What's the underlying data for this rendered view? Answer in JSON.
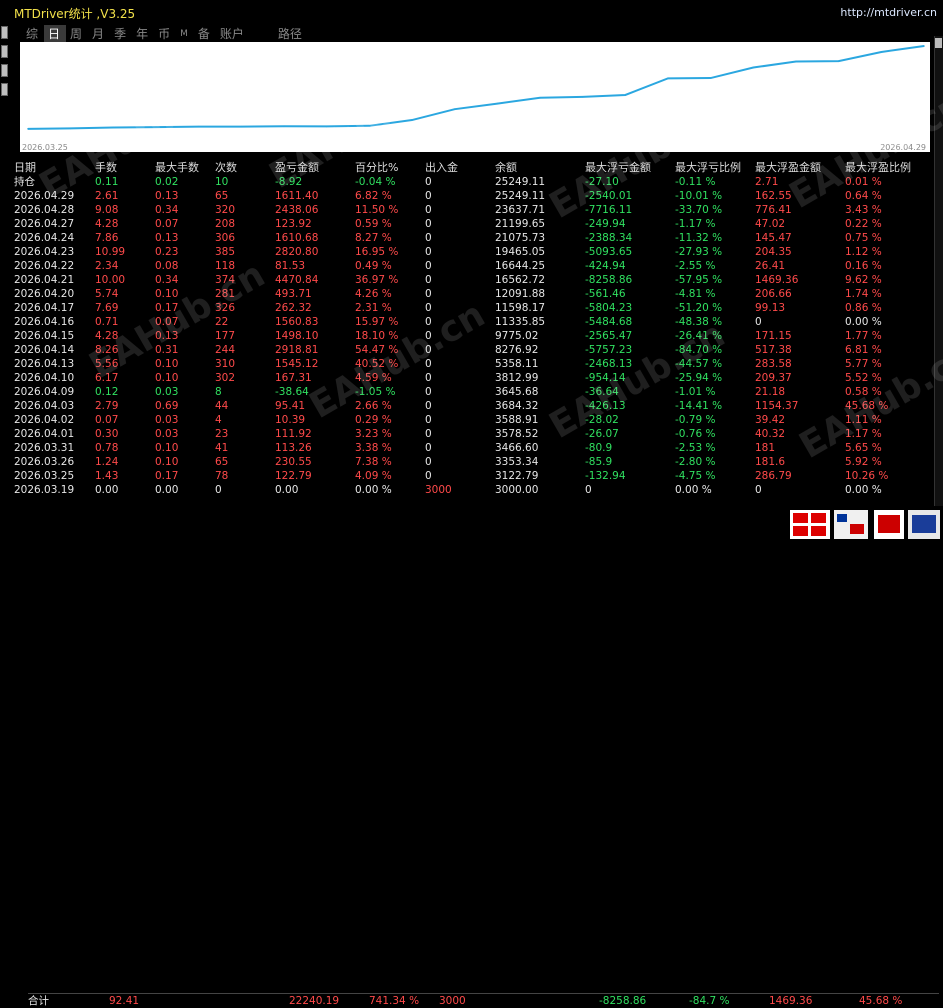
{
  "title": "MTDriver统计 ,V3.25",
  "url": "http://mtdriver.cn",
  "tabs": [
    "综",
    "日",
    "周",
    "月",
    "季",
    "年",
    "币",
    "M",
    "备",
    "账户",
    "路径"
  ],
  "active_tab": "日",
  "chart_data": {
    "type": "line",
    "x_start_label": "2026.03.25",
    "x_end_label": "2026.04.29",
    "x": [
      "2026.03.19",
      "2026.03.25",
      "2026.03.26",
      "2026.03.31",
      "2026.04.01",
      "2026.04.02",
      "2026.04.03",
      "2026.04.09",
      "2026.04.10",
      "2026.04.13",
      "2026.04.14",
      "2026.04.15",
      "2026.04.16",
      "2026.04.17",
      "2026.04.20",
      "2026.04.21",
      "2026.04.22",
      "2026.04.23",
      "2026.04.24",
      "2026.04.27",
      "2026.04.28",
      "2026.04.29"
    ],
    "values": [
      3000.0,
      3122.79,
      3353.34,
      3466.6,
      3578.52,
      3588.91,
      3684.32,
      3645.68,
      3812.99,
      5358.11,
      8276.92,
      9775.02,
      11335.85,
      11598.17,
      12091.88,
      16562.72,
      16644.25,
      19465.05,
      21075.73,
      21199.65,
      23637.71,
      25249.11
    ],
    "line_color": "#2ba7e0"
  },
  "headers": [
    "日期",
    "手数",
    "最大手数",
    "次数",
    "盈亏金额",
    "百分比%",
    "出入金",
    "余额",
    "最大浮亏金额",
    "最大浮亏比例",
    "最大浮盈金额",
    "最大浮盈比例"
  ],
  "position_row": [
    "持仓",
    "0.11",
    "0.02",
    "10",
    "-8.92",
    "-0.04 %",
    "0",
    "25249.11",
    "-27.10",
    "-0.11 %",
    "2.71",
    "0.01 %"
  ],
  "rows": [
    [
      "2026.04.29",
      "2.61",
      "0.13",
      "65",
      "1611.40",
      "6.82 %",
      "0",
      "25249.11",
      "-2540.01",
      "-10.01 %",
      "162.55",
      "0.64 %"
    ],
    [
      "2026.04.28",
      "9.08",
      "0.34",
      "320",
      "2438.06",
      "11.50 %",
      "0",
      "23637.71",
      "-7716.11",
      "-33.70 %",
      "776.41",
      "3.43 %"
    ],
    [
      "2026.04.27",
      "4.28",
      "0.07",
      "208",
      "123.92",
      "0.59 %",
      "0",
      "21199.65",
      "-249.94",
      "-1.17 %",
      "47.02",
      "0.22 %"
    ],
    [
      "2026.04.24",
      "7.86",
      "0.13",
      "306",
      "1610.68",
      "8.27 %",
      "0",
      "21075.73",
      "-2388.34",
      "-11.32 %",
      "145.47",
      "0.75 %"
    ],
    [
      "2026.04.23",
      "10.99",
      "0.23",
      "385",
      "2820.80",
      "16.95 %",
      "0",
      "19465.05",
      "-5093.65",
      "-27.93 %",
      "204.35",
      "1.12 %"
    ],
    [
      "2026.04.22",
      "2.34",
      "0.08",
      "118",
      "81.53",
      "0.49 %",
      "0",
      "16644.25",
      "-424.94",
      "-2.55 %",
      "26.41",
      "0.16 %"
    ],
    [
      "2026.04.21",
      "10.00",
      "0.34",
      "374",
      "4470.84",
      "36.97 %",
      "0",
      "16562.72",
      "-8258.86",
      "-57.95 %",
      "1469.36",
      "9.62 %"
    ],
    [
      "2026.04.20",
      "5.74",
      "0.10",
      "281",
      "493.71",
      "4.26 %",
      "0",
      "12091.88",
      "-561.46",
      "-4.81 %",
      "206.66",
      "1.74 %"
    ],
    [
      "2026.04.17",
      "7.69",
      "0.17",
      "326",
      "262.32",
      "2.31 %",
      "0",
      "11598.17",
      "-5804.23",
      "-51.20 %",
      "99.13",
      "0.86 %"
    ],
    [
      "2026.04.16",
      "0.71",
      "0.07",
      "22",
      "1560.83",
      "15.97 %",
      "0",
      "11335.85",
      "-5484.68",
      "-48.38 %",
      "0",
      "0.00 %"
    ],
    [
      "2026.04.15",
      "4.28",
      "0.13",
      "177",
      "1498.10",
      "18.10 %",
      "0",
      "9775.02",
      "-2565.47",
      "-26.41 %",
      "171.15",
      "1.77 %"
    ],
    [
      "2026.04.14",
      "8.26",
      "0.31",
      "244",
      "2918.81",
      "54.47 %",
      "0",
      "8276.92",
      "-5757.23",
      "-84.70 %",
      "517.38",
      "6.81 %"
    ],
    [
      "2026.04.13",
      "5.56",
      "0.10",
      "310",
      "1545.12",
      "40.52 %",
      "0",
      "5358.11",
      "-2468.13",
      "-44.57 %",
      "283.58",
      "5.77 %"
    ],
    [
      "2026.04.10",
      "6.17",
      "0.10",
      "302",
      "167.31",
      "4.59 %",
      "0",
      "3812.99",
      "-954.14",
      "-25.94 %",
      "209.37",
      "5.52 %"
    ],
    [
      "2026.04.09",
      "0.12",
      "0.03",
      "8",
      "-38.64",
      "-1.05 %",
      "0",
      "3645.68",
      "-36.64",
      "-1.01 %",
      "21.18",
      "0.58 %"
    ],
    [
      "2026.04.03",
      "2.79",
      "0.69",
      "44",
      "95.41",
      "2.66 %",
      "0",
      "3684.32",
      "-426.13",
      "-14.41 %",
      "1154.37",
      "45.68 %"
    ],
    [
      "2026.04.02",
      "0.07",
      "0.03",
      "4",
      "10.39",
      "0.29 %",
      "0",
      "3588.91",
      "-28.02",
      "-0.79 %",
      "39.42",
      "1.11 %"
    ],
    [
      "2026.04.01",
      "0.30",
      "0.03",
      "23",
      "111.92",
      "3.23 %",
      "0",
      "3578.52",
      "-26.07",
      "-0.76 %",
      "40.32",
      "1.17 %"
    ],
    [
      "2026.03.31",
      "0.78",
      "0.10",
      "41",
      "113.26",
      "3.38 %",
      "0",
      "3466.60",
      "-80.9",
      "-2.53 %",
      "181",
      "5.65 %"
    ],
    [
      "2026.03.26",
      "1.24",
      "0.10",
      "65",
      "230.55",
      "7.38 %",
      "0",
      "3353.34",
      "-85.9",
      "-2.80 %",
      "181.6",
      "5.92 %"
    ],
    [
      "2026.03.25",
      "1.43",
      "0.17",
      "78",
      "122.79",
      "4.09 %",
      "0",
      "3122.79",
      "-132.94",
      "-4.75 %",
      "286.79",
      "10.26 %"
    ],
    [
      "2026.03.19",
      "0.00",
      "0.00",
      "0",
      "0.00",
      "0.00 %",
      "3000",
      "3000.00",
      "0",
      "0.00 %",
      "0",
      "0.00 %"
    ]
  ],
  "total_row": [
    "合计",
    "92.41",
    "",
    "",
    "22240.19",
    "741.34 %",
    "3000",
    "",
    "-8258.86",
    "-84.7 %",
    "1469.36",
    "45.68 %"
  ],
  "watermark": "EAHub.cn"
}
